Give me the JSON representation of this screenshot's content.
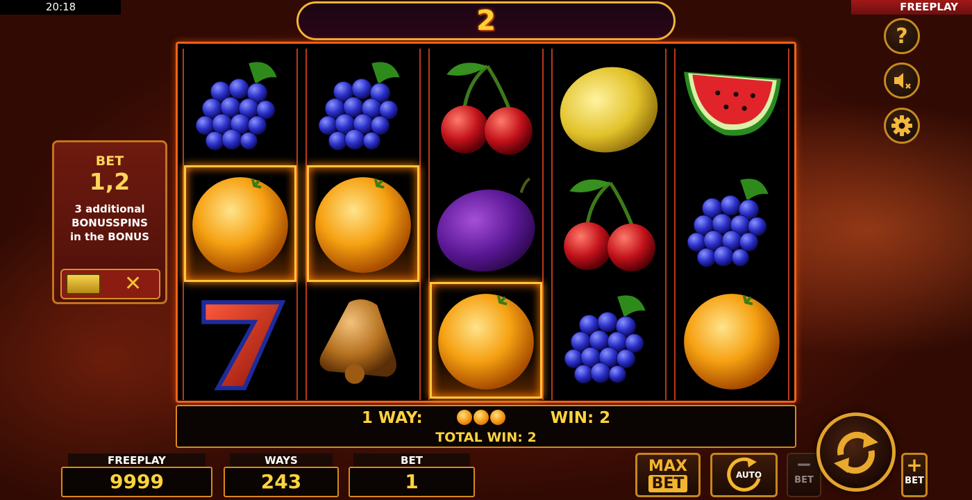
{
  "status_bar": {
    "time": "20:18",
    "mode": "FREEPLAY"
  },
  "counter": {
    "value": "2"
  },
  "side_buttons": [
    {
      "name": "help",
      "icon": "question-icon"
    },
    {
      "name": "sound",
      "icon": "speaker-muted-icon"
    },
    {
      "name": "settings",
      "icon": "gear-icon"
    }
  ],
  "bet_panel": {
    "title": "BET",
    "value": "1,2",
    "line1": "3 additional",
    "line2": "BONUSSPINS",
    "line3": "in the BONUS",
    "toggle_state": "off"
  },
  "reels": [
    [
      "grapes",
      "orange",
      "seven"
    ],
    [
      "grapes",
      "orange",
      "bell"
    ],
    [
      "cherries",
      "plum",
      "orange"
    ],
    [
      "lemon",
      "cherries",
      "grapes"
    ],
    [
      "watermelon",
      "grapes",
      "orange"
    ]
  ],
  "winning_cells": [
    [
      0,
      1
    ],
    [
      1,
      1
    ],
    [
      2,
      2
    ]
  ],
  "win_info": {
    "ways_text": "1 WAY:",
    "win_text": "WIN: 2",
    "total_text": "TOTAL WIN: 2"
  },
  "stats": {
    "freeplay_label": "FREEPLAY",
    "freeplay_value": "9999",
    "ways_label": "WAYS",
    "ways_value": "243",
    "bet_label": "BET",
    "bet_value": "1"
  },
  "controls": {
    "max_label": "MAX",
    "bet_label": "BET",
    "auto_label": "AUTO",
    "minus_label": "BET",
    "plus_label": "BET"
  },
  "colors": {
    "accent": "#ffd33d",
    "frame": "#f0601c",
    "background": "#5a1608"
  }
}
